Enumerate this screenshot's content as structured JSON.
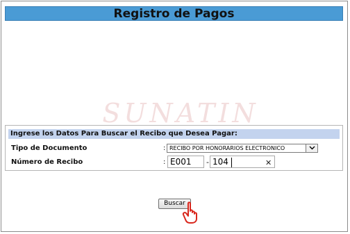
{
  "header": {
    "title": "Registro de Pagos"
  },
  "watermark": {
    "text": "SUNATIN"
  },
  "form": {
    "section_title": "Ingrese los Datos Para Buscar el Recibo que Desea Pagar:",
    "tipo_documento": {
      "label": "Tipo de Documento",
      "colon": ":",
      "selected": "RECIBO POR HONORARIOS ELECTRONICO"
    },
    "numero_recibo": {
      "label": "Número de Recibo",
      "colon": ":",
      "serie_value": "E001",
      "separator": "-",
      "numero_value": "104"
    },
    "search_button": "Buscar"
  },
  "icons": {
    "clear": "close-icon",
    "dropdown": "chevron-down-icon",
    "cursor": "hand-pointer-icon"
  },
  "colors": {
    "title_bar": "#4a9bd5",
    "section_header": "#c3d3ee",
    "watermark": "#f3dede"
  }
}
